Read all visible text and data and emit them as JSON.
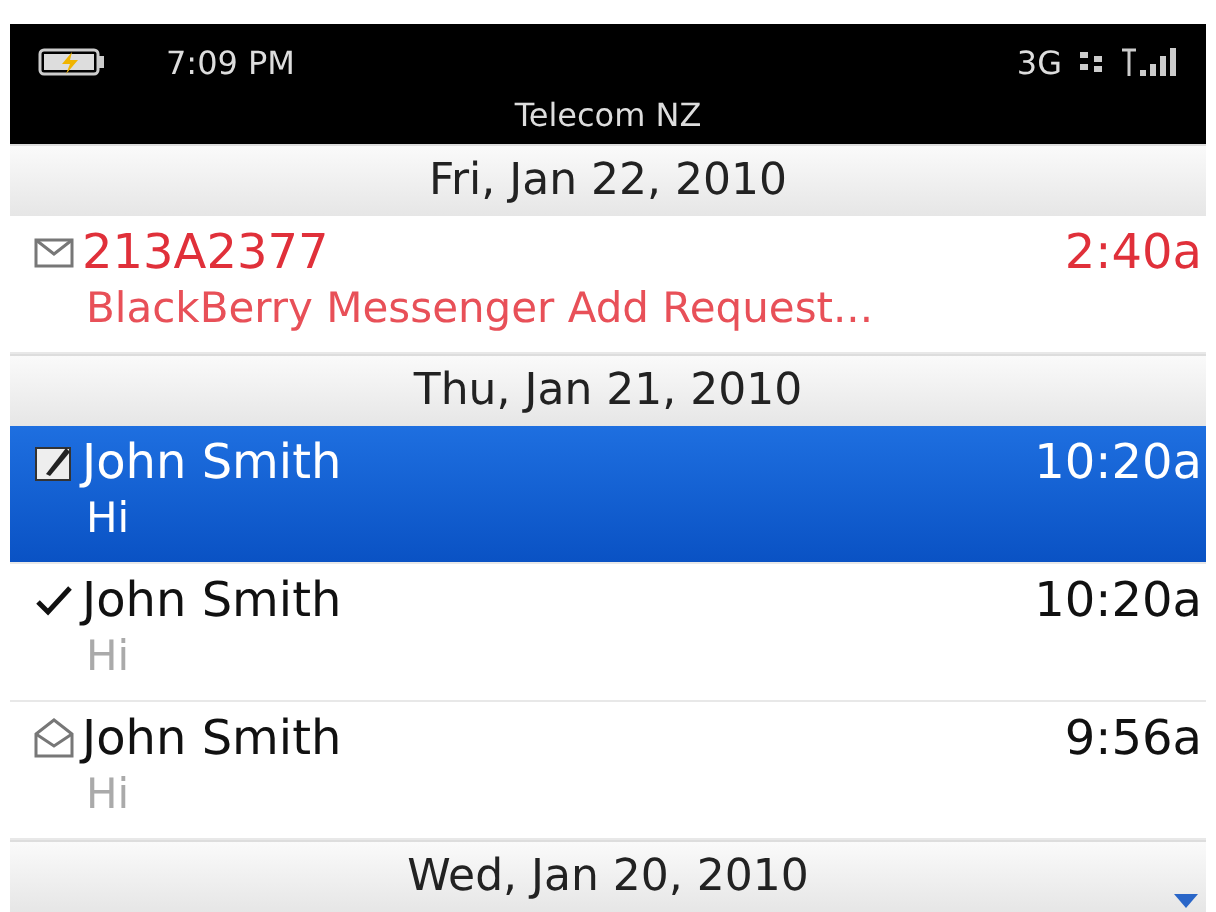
{
  "status_bar": {
    "time": "7:09 PM",
    "carrier": "Telecom NZ",
    "network": "3G",
    "charging": true
  },
  "groups": [
    {
      "date": "Fri, Jan 22, 2010",
      "messages": [
        {
          "kind": "unopened",
          "sender": "213A2377",
          "time": "2:40a",
          "preview": "BlackBerry Messenger Add Request...",
          "selected": false,
          "alert": true
        }
      ]
    },
    {
      "date": "Thu, Jan 21, 2010",
      "messages": [
        {
          "kind": "draft",
          "sender": "John Smith",
          "time": "10:20a",
          "preview": "Hi",
          "selected": true,
          "alert": false
        },
        {
          "kind": "delivered",
          "sender": "John Smith",
          "time": "10:20a",
          "preview": "Hi",
          "selected": false,
          "alert": false
        },
        {
          "kind": "opened",
          "sender": "John Smith",
          "time": "9:56a",
          "preview": "Hi",
          "selected": false,
          "alert": false
        }
      ]
    },
    {
      "date": "Wed, Jan 20, 2010",
      "more_below": true
    }
  ]
}
